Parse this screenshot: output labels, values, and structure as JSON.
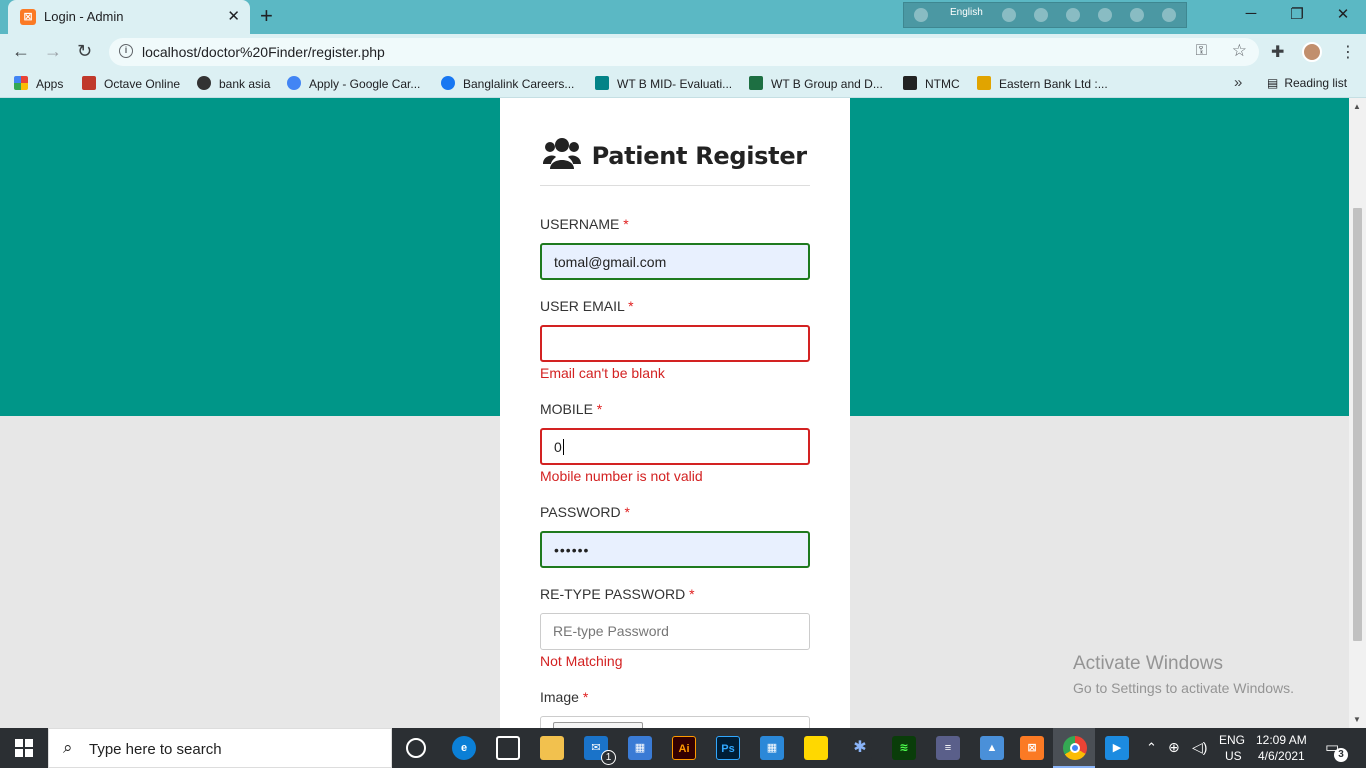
{
  "browser": {
    "tab_title": "Login - Admin",
    "url": "localhost/doctor%20Finder/register.php",
    "ime_language": "English",
    "bookmarks": [
      {
        "label": "Apps",
        "color": "#ea4335"
      },
      {
        "label": "Octave Online",
        "color": "#c0392b"
      },
      {
        "label": "bank asia",
        "color": "#333333"
      },
      {
        "label": "Apply - Google Car...",
        "color": "#4285f4"
      },
      {
        "label": "Banglalink Careers...",
        "color": "#1877f2"
      },
      {
        "label": "WT B MID- Evaluati...",
        "color": "#038387"
      },
      {
        "label": "WT B Group and D...",
        "color": "#1d6f42"
      },
      {
        "label": "NTMC",
        "color": "#222222"
      },
      {
        "label": "Eastern Bank Ltd :...",
        "color": "#e1a400"
      }
    ],
    "reading_list": "Reading list"
  },
  "form": {
    "title": "Patient Register",
    "username": {
      "label": "USERNAME",
      "value": "tomal@gmail.com"
    },
    "email": {
      "label": "USER EMAIL",
      "value": "",
      "error": "Email can't be blank"
    },
    "mobile": {
      "label": "MOBILE",
      "value": "0",
      "error": "Mobile number is not valid"
    },
    "password": {
      "label": "PASSWORD",
      "value": "••••••"
    },
    "retype": {
      "label": "RE-TYPE PASSWORD",
      "placeholder": "RE-type Password",
      "error": "Not Matching"
    },
    "image": {
      "label": "Image"
    },
    "required_mark": "*"
  },
  "watermark": {
    "line1": "Activate Windows",
    "line2": "Go to Settings to activate Windows."
  },
  "taskbar": {
    "search_placeholder": "Type here to search",
    "lang_top": "ENG",
    "lang_bottom": "US",
    "time": "12:09 AM",
    "date": "4/6/2021",
    "notification_count": "3",
    "mail_badge": "1"
  },
  "colors": {
    "teal": "#009688",
    "error": "#d32222",
    "valid": "#1e7a1e"
  }
}
